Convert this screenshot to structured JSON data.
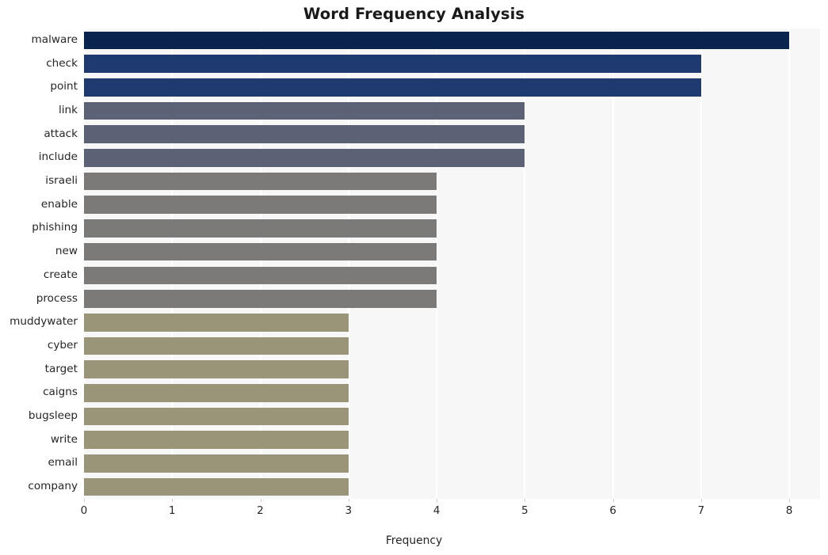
{
  "chart_data": {
    "type": "bar",
    "orientation": "horizontal",
    "title": "Word Frequency Analysis",
    "xlabel": "Frequency",
    "ylabel": "",
    "xlim": [
      0,
      8.35
    ],
    "xticks": [
      0,
      1,
      2,
      3,
      4,
      5,
      6,
      7,
      8
    ],
    "xtick_labels": [
      "0",
      "1",
      "2",
      "3",
      "4",
      "5",
      "6",
      "7",
      "8"
    ],
    "grid": "vertical-white-on-light-gray",
    "legend": "none",
    "categories": [
      "malware",
      "check",
      "point",
      "link",
      "attack",
      "include",
      "israeli",
      "enable",
      "phishing",
      "new",
      "create",
      "process",
      "muddywater",
      "cyber",
      "target",
      "caigns",
      "bugsleep",
      "write",
      "email",
      "company"
    ],
    "values": [
      8,
      7,
      7,
      5,
      5,
      5,
      4,
      4,
      4,
      4,
      4,
      4,
      3,
      3,
      3,
      3,
      3,
      3,
      3,
      3
    ],
    "bar_colors": [
      "#0a2450",
      "#1e3a6e",
      "#1e3a6e",
      "#5c6275",
      "#5c6275",
      "#5c6275",
      "#7b7a78",
      "#7b7a78",
      "#7b7a78",
      "#7b7a78",
      "#7b7a78",
      "#7b7a78",
      "#9a9478",
      "#9a9478",
      "#9a9478",
      "#9a9478",
      "#9a9478",
      "#9a9478",
      "#9a9478",
      "#9a9478"
    ],
    "plot_background": "#f7f7f7",
    "figure_background": "#ffffff",
    "gridline_color": "#ffffff",
    "text_color": "#262626"
  }
}
